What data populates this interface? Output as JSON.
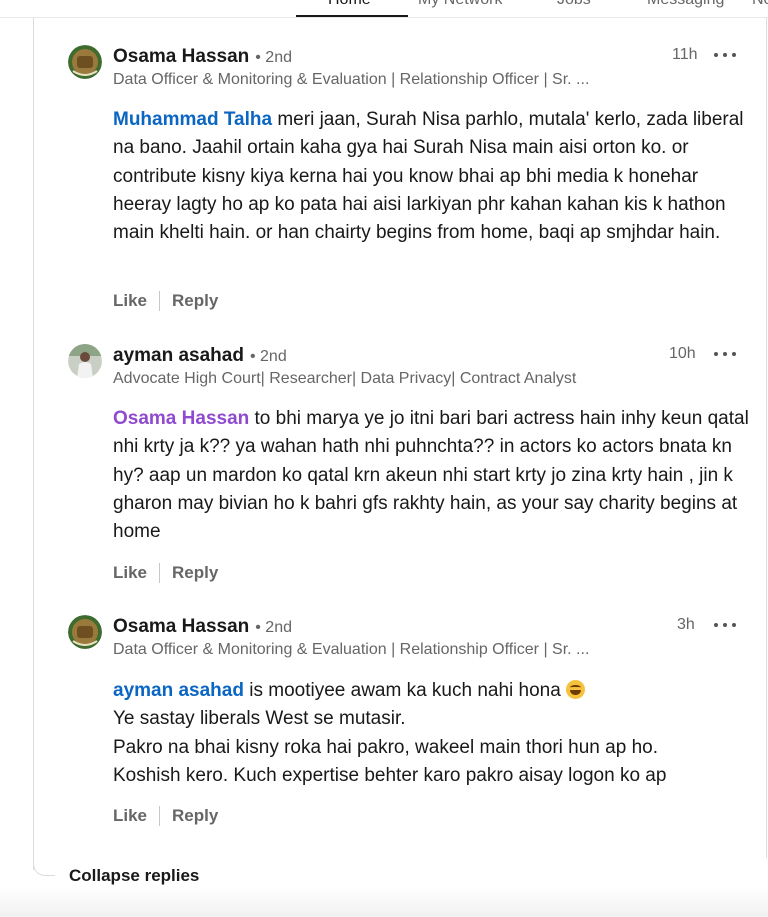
{
  "nav": {
    "items": [
      "Home",
      "My Network",
      "Jobs",
      "Messaging",
      "No"
    ]
  },
  "comments": [
    {
      "author": "Osama Hassan",
      "degree": "• 2nd",
      "headline": "Data Officer & Monitoring & Evaluation | Relationship Officer | Sr. ...",
      "time": "11h",
      "mention": "Muhammad Talha",
      "text": " meri jaan, Surah Nisa parhlo, mutala' kerlo, zada liberal na bano. Jaahil ortain kaha gya hai Surah Nisa main aisi orton ko. or contribute kisny kiya kerna hai you know bhai ap bhi media k honehar heeray lagty ho ap ko pata hai aisi larkiyan phr kahan kahan kis k hathon main khelti hain. or han chairty begins from home, baqi ap smjhdar hain.",
      "like": "Like",
      "reply": "Reply"
    },
    {
      "author": "ayman asahad",
      "degree": "• 2nd",
      "headline": "Advocate High Court| Researcher| Data Privacy| Contract Analyst",
      "time": "10h",
      "mention": "Osama Hassan",
      "text": " to bhi marya ye jo itni bari bari actress hain inhy keun qatal nhi krty ja k?? ya wahan hath nhi puhnchta?? in actors ko actors bnata kn hy? aap un mardon ko qatal krn akeun nhi start krty jo zina krty hain , jin k gharon may bivian ho k bahri gfs rakhty hain, as your say charity begins at home",
      "like": "Like",
      "reply": "Reply"
    },
    {
      "author": "Osama Hassan",
      "degree": "• 2nd",
      "headline": "Data Officer & Monitoring & Evaluation | Relationship Officer | Sr. ...",
      "time": "3h",
      "mention": "ayman asahad",
      "text_line1": " is mootiyee awam ka kuch nahi hona ",
      "emoji": "laughing-emoji",
      "text_line2": "Ye sastay liberals West se mutasir.",
      "text_line3": "Pakro na bhai kisny roka hai pakro, wakeel main thori hun ap ho.",
      "text_line4": "Koshish kero. Kuch expertise behter karo pakro aisay logon ko ap",
      "like": "Like",
      "reply": "Reply"
    }
  ],
  "collapse_label": "Collapse replies"
}
